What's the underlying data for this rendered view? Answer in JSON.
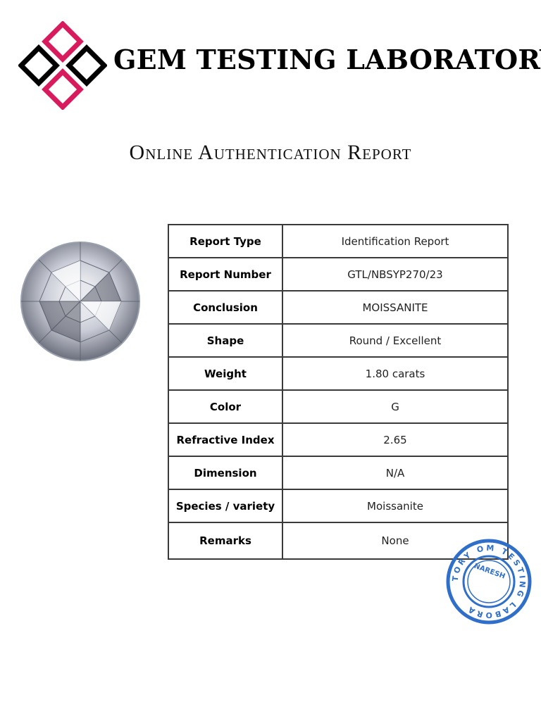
{
  "header": {
    "brand_name": "GEM TESTING LABORATORY",
    "logo_icon": "diamond-pattern-logo-icon",
    "logo_colors": {
      "outer": "#000000",
      "accent": "#d81b5c"
    }
  },
  "report_title": "Online Authentication Report",
  "gem_image": "round-brilliant-gemstone-image",
  "table": {
    "rows": [
      {
        "label": "Report Type",
        "value": "Identification Report"
      },
      {
        "label": "Report Number",
        "value": "GTL/NBSYP270/23"
      },
      {
        "label": "Conclusion",
        "value": "MOISSANITE"
      },
      {
        "label": "Shape",
        "value": "Round / Excellent"
      },
      {
        "label": "Weight",
        "value": "1.80 carats"
      },
      {
        "label": "Color",
        "value": "G"
      },
      {
        "label": "Refractive Index",
        "value": "2.65"
      },
      {
        "label": "Dimension",
        "value": "N/A"
      },
      {
        "label": "Species / variety",
        "value": "Moissanite"
      },
      {
        "label": "Remarks",
        "value": "None"
      }
    ]
  },
  "stamp": {
    "ring_text": "TORY OM TESTING LABORA",
    "center_text": "NARESH",
    "color": "#2f6fc9"
  }
}
